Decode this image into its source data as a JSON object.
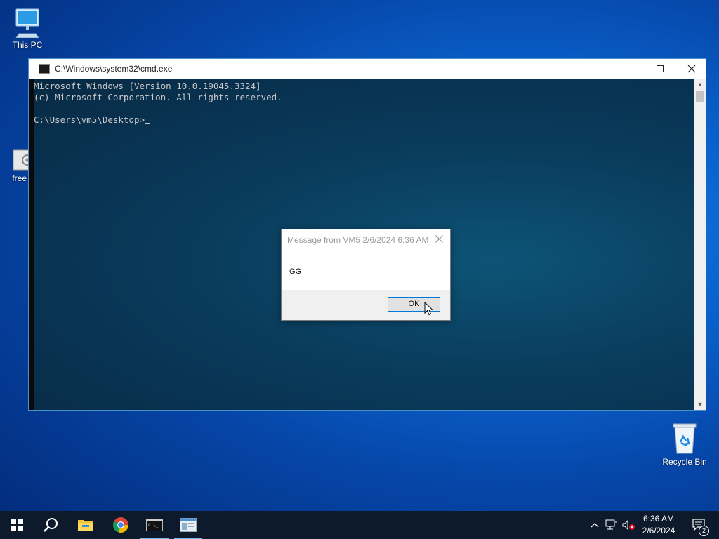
{
  "desktop": {
    "icons": [
      {
        "label": "This PC",
        "icon": "computer-icon"
      },
      {
        "label": "free bux",
        "icon": "app-icon"
      },
      {
        "label": "Recycle Bin",
        "icon": "recycle-bin-icon"
      }
    ]
  },
  "cmd_window": {
    "title": "C:\\Windows\\system32\\cmd.exe",
    "lines": [
      "Microsoft Windows [Version 10.0.19045.3324]",
      "(c) Microsoft Corporation. All rights reserved.",
      "",
      "C:\\Users\\vm5\\Desktop>"
    ]
  },
  "message_box": {
    "title": "Message from VM5 2/6/2024 6:36 AM",
    "body": "GG",
    "ok_label": "OK"
  },
  "taskbar": {
    "apps": [
      {
        "icon": "start-icon"
      },
      {
        "icon": "search-icon"
      },
      {
        "icon": "file-explorer-icon"
      },
      {
        "icon": "chrome-icon"
      },
      {
        "icon": "cmd-icon",
        "active": true
      },
      {
        "icon": "window-app-icon",
        "active": true
      }
    ],
    "clock_time": "6:36 AM",
    "clock_date": "2/6/2024",
    "notification_count": "2"
  },
  "colors": {
    "accent": "#0078d7",
    "taskbar": "#0c1a2b"
  }
}
